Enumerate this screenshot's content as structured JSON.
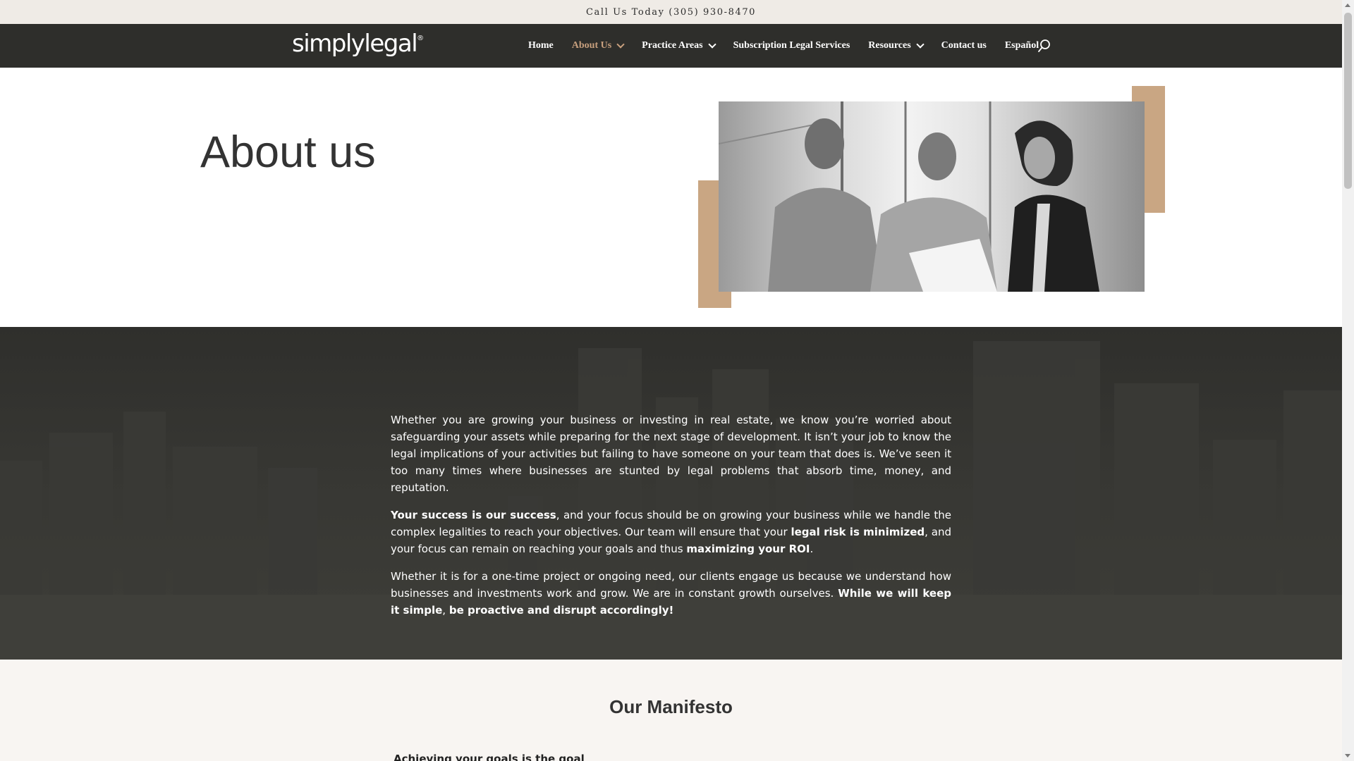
{
  "topbar": {
    "text": "Call Us Today (305) 930-8470"
  },
  "nav": {
    "logo_text": "simplylegal",
    "logo_mark": "®",
    "items": [
      {
        "label": "Home",
        "active": false,
        "dropdown": false
      },
      {
        "label": "About Us",
        "active": true,
        "dropdown": true
      },
      {
        "label": "Practice Areas",
        "active": false,
        "dropdown": true
      },
      {
        "label": "Subscription Legal Services",
        "active": false,
        "dropdown": false
      },
      {
        "label": "Resources",
        "active": false,
        "dropdown": true
      },
      {
        "label": "Contact us",
        "active": false,
        "dropdown": false
      },
      {
        "label": "Español",
        "active": false,
        "dropdown": false
      }
    ],
    "search_icon": "search-icon"
  },
  "hero": {
    "title": "About us",
    "image_alt": "three business people reviewing a document"
  },
  "intro": {
    "p1": "Whether you are growing your business or investing in real estate, we know you’re worried about safeguarding your assets while preparing for the next stage of development. It isn’t your job to know the legal implications of your activities but failing to have someone on your team that does is. We’ve seen it too many times where businesses are stunted by legal problems that absorb time, money, and reputation.",
    "p2_bold1": "Your success is our success",
    "p2_text1": ", and your focus should be on growing your business while we handle the complex legalities to reach your objectives. Our team will ensure that your ",
    "p2_bold2": "legal risk is minimized",
    "p2_text2": ", and your focus can remain on reaching your goals and thus ",
    "p2_bold3": "maximizing your ROI",
    "p2_text3": ".",
    "p3_text1": "Whether it is for a one-time project or ongoing need, our clients engage us because we understand how businesses and investments work and grow. We are in constant growth ourselves. ",
    "p3_bold1": "While we will keep it simple",
    "p3_text2": ", ",
    "p3_bold2": "be proactive and disrupt accordingly!"
  },
  "manifesto": {
    "title": "Our Manifesto",
    "subtitle": "Achieving your goals is the goal"
  },
  "colors": {
    "accent": "#c9a683",
    "nav_bg": "#2e2e2b",
    "active_link": "#c8a07e"
  }
}
